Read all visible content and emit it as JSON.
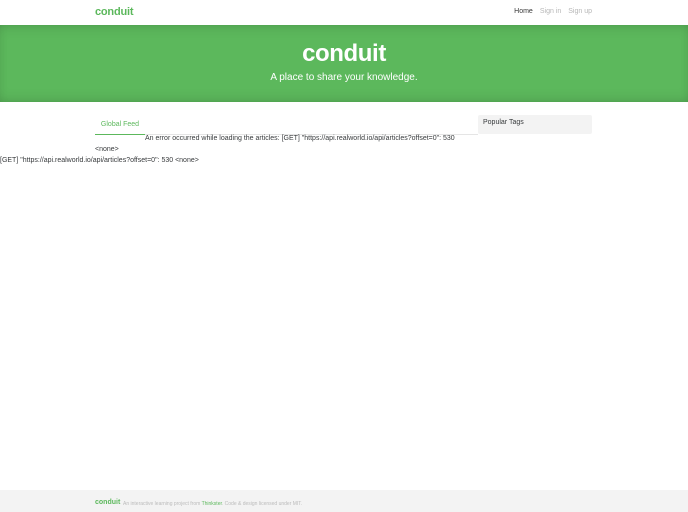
{
  "navbar": {
    "brand": "conduit",
    "links": [
      {
        "label": "Home"
      },
      {
        "label": "Sign in"
      },
      {
        "label": "Sign up"
      }
    ]
  },
  "banner": {
    "title": "conduit",
    "subtitle": "A place to share your knowledge."
  },
  "feed": {
    "tabs": [
      {
        "label": "Global Feed"
      }
    ],
    "error_line_1": "An error occurred while loading the articles: [GET] \"https://api.realworld.io/api/articles?offset=0\": 530",
    "error_line_2": "<none>",
    "error_line_3": "[GET] \"https://api.realworld.io/api/articles?offset=0\": 530 <none>"
  },
  "sidebar": {
    "title": "Popular Tags"
  },
  "footer": {
    "logo": "conduit",
    "attribution_prefix": "An interactive learning project from",
    "attribution_link": "Thinkster",
    "attribution_suffix": ". Code & design licensed under MIT."
  },
  "colors": {
    "brand": "#5cb85c",
    "footer_bg": "#f3f3f3",
    "sidebar_bg": "#f3f3f3"
  }
}
